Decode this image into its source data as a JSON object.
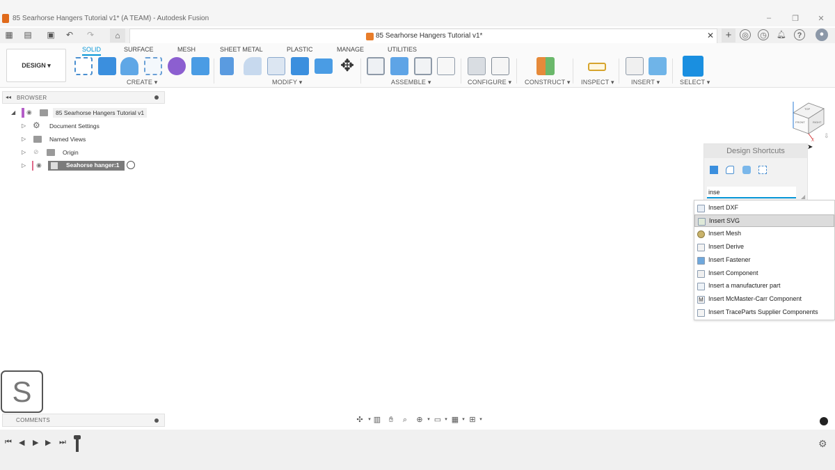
{
  "window": {
    "title": "85 Searhorse Hangers Tutorial v1* (A TEAM) - Autodesk Fusion",
    "document_tab": "85 Searhorse Hangers Tutorial v1*"
  },
  "workspace": {
    "label": "DESIGN ▾"
  },
  "ribbon": {
    "tabs": [
      "SOLID",
      "SURFACE",
      "MESH",
      "SHEET METAL",
      "PLASTIC",
      "MANAGE",
      "UTILITIES"
    ],
    "groups": [
      "CREATE ▾",
      "MODIFY ▾",
      "ASSEMBLE ▾",
      "CONFIGURE ▾",
      "CONSTRUCT ▾",
      "INSPECT ▾",
      "INSERT ▾",
      "SELECT ▾"
    ]
  },
  "browser": {
    "title": "BROWSER",
    "root": "85 Searhorse Hangers Tutorial v1",
    "items": [
      "Document Settings",
      "Named Views",
      "Origin",
      "Seahorse hanger:1"
    ]
  },
  "shortcuts": {
    "title": "Design Shortcuts",
    "search_value": "inse",
    "results": [
      "Insert DXF",
      "Insert SVG",
      "Insert Mesh",
      "Insert Derive",
      "Insert Fastener",
      "Insert Component",
      "Insert a manufacturer part",
      "Insert McMaster-Carr Component",
      "Insert TraceParts Supplier Components"
    ]
  },
  "avatar_letter": "S",
  "comments": {
    "title": "COMMENTS"
  },
  "viewcube": {
    "top": "TOP",
    "front": "FRONT",
    "right": "RIGHT"
  },
  "colors": {
    "accent": "#0696d7",
    "highlight": "#dcdcdc"
  }
}
